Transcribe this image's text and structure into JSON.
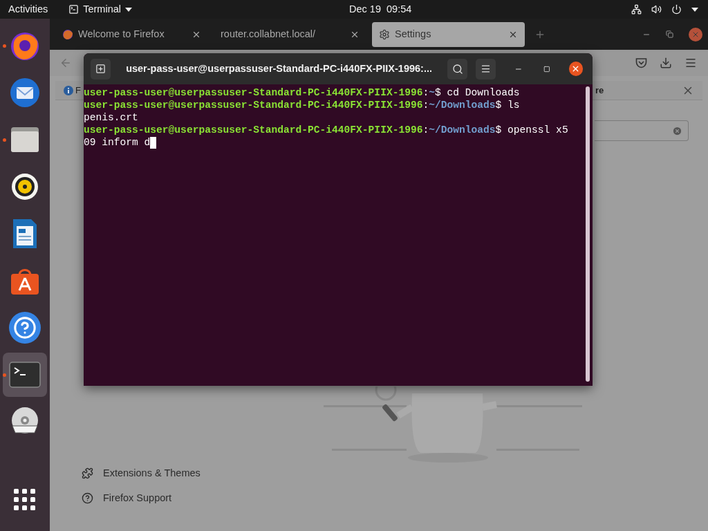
{
  "top_bar": {
    "activities": "Activities",
    "app_menu": "Terminal",
    "clock": "Dec 19  09:54"
  },
  "dock": {
    "items": [
      {
        "kind": "browser",
        "running": true,
        "selected": false
      },
      {
        "kind": "mail",
        "running": false,
        "selected": false
      },
      {
        "kind": "folder",
        "running": true,
        "selected": false
      },
      {
        "kind": "speaker",
        "running": false,
        "selected": false
      },
      {
        "kind": "document",
        "running": false,
        "selected": false
      },
      {
        "kind": "bag",
        "running": false,
        "selected": false
      },
      {
        "kind": "help",
        "running": false,
        "selected": false
      },
      {
        "kind": "terminal",
        "running": true,
        "selected": true
      },
      {
        "kind": "disc",
        "running": false,
        "selected": false
      },
      {
        "kind": "grid",
        "running": false,
        "selected": false
      }
    ]
  },
  "browser": {
    "tabs": [
      {
        "title": "Welcome to Firefox",
        "kind": "browser",
        "selected": false
      },
      {
        "title": "router.collabnet.local/",
        "kind": "page",
        "selected": false
      },
      {
        "title": "Settings",
        "kind": "settings",
        "selected": true
      }
    ],
    "notification": {
      "text_left": "F",
      "text_right": "re"
    },
    "search": {
      "clear_button": true
    },
    "footer_links": [
      {
        "label": "Extensions & Themes",
        "kind": "extensions"
      },
      {
        "label": "Firefox Support",
        "kind": "support"
      }
    ]
  },
  "terminal": {
    "title": "user-pass-user@userpassuser-Standard-PC-i440FX-PIIX-1996:...",
    "cursor": true,
    "rows": [
      [
        {
          "kind": "user",
          "text": "user-pass-user@userpassuser-Standard-PC-i440FX-PIIX-1996"
        },
        {
          "kind": "plain",
          "text": ":"
        },
        {
          "kind": "path",
          "text": "~"
        },
        {
          "kind": "plain",
          "text": "$ cd Downloads"
        }
      ],
      [
        {
          "kind": "user",
          "text": "user-pass-user@userpassuser-Standard-PC-i440FX-PIIX-1996"
        },
        {
          "kind": "plain",
          "text": ":"
        },
        {
          "kind": "path",
          "text": "~/Downloads"
        },
        {
          "kind": "plain",
          "text": "$ ls"
        }
      ],
      [
        {
          "kind": "plain",
          "text": "penis.crt"
        }
      ],
      [
        {
          "kind": "user",
          "text": "user-pass-user@userpassuser-Standard-PC-i440FX-PIIX-1996"
        },
        {
          "kind": "plain",
          "text": ":"
        },
        {
          "kind": "path",
          "text": "~/Downloads"
        },
        {
          "kind": "plain",
          "text": "$ openssl x5"
        }
      ],
      [
        {
          "kind": "plain",
          "text": "09 inform d"
        }
      ]
    ]
  }
}
